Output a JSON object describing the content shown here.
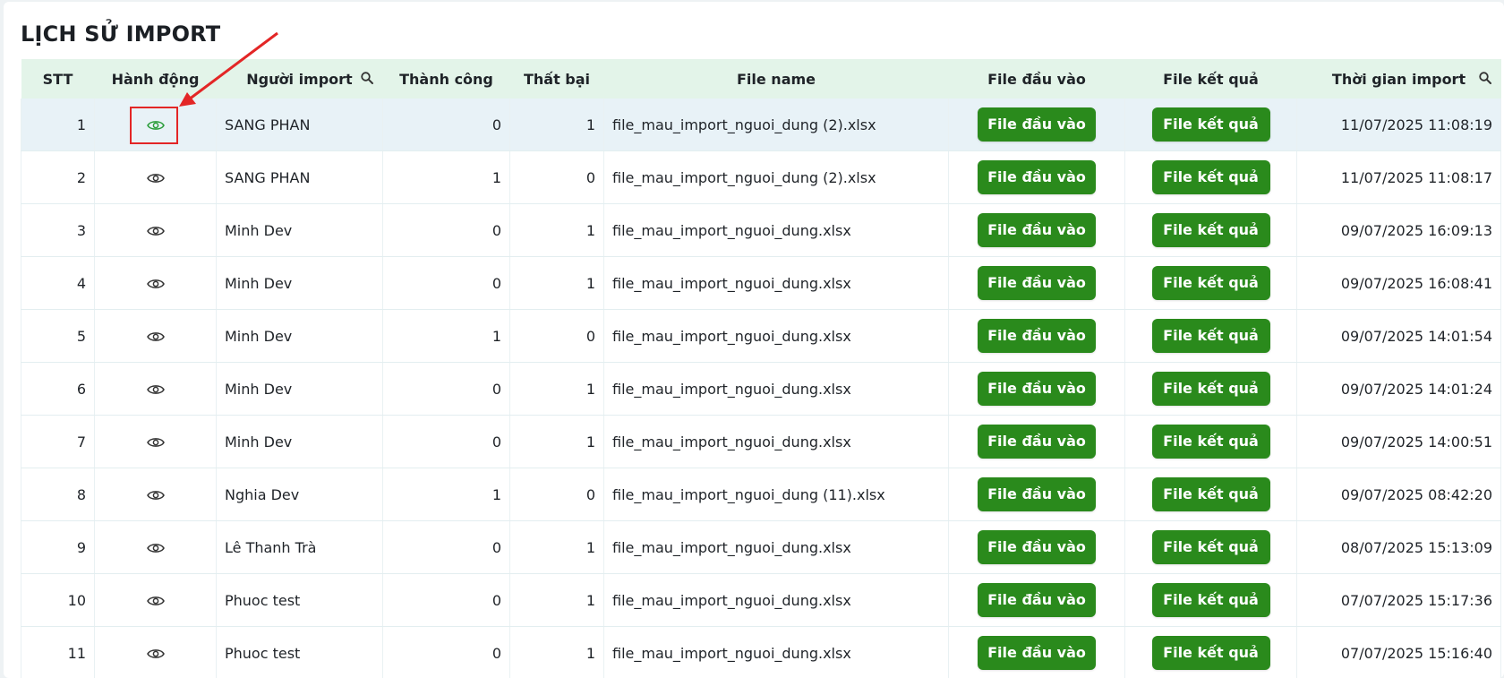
{
  "page": {
    "title": "LỊCH SỬ IMPORT"
  },
  "table": {
    "columns": [
      {
        "label": "STT"
      },
      {
        "label": "Hành động"
      },
      {
        "label": "Người import",
        "icon": "search-icon"
      },
      {
        "label": "Thành công"
      },
      {
        "label": "Thất bại"
      },
      {
        "label": "File name"
      },
      {
        "label": "File đầu vào"
      },
      {
        "label": "File kết quả"
      },
      {
        "label": "Thời gian import",
        "icon": "search-icon"
      }
    ],
    "action_icon": "eye-icon",
    "input_button_label": "File đầu vào",
    "result_button_label": "File kết quả",
    "rows": [
      {
        "stt": "1",
        "user": "SANG PHAN",
        "success": "0",
        "failed": "1",
        "file_name": "file_mau_import_nguoi_dung (2).xlsx",
        "time": "11/07/2025 11:08:19",
        "selected": true
      },
      {
        "stt": "2",
        "user": "SANG PHAN",
        "success": "1",
        "failed": "0",
        "file_name": "file_mau_import_nguoi_dung (2).xlsx",
        "time": "11/07/2025 11:08:17"
      },
      {
        "stt": "3",
        "user": "Minh Dev",
        "success": "0",
        "failed": "1",
        "file_name": "file_mau_import_nguoi_dung.xlsx",
        "time": "09/07/2025 16:09:13"
      },
      {
        "stt": "4",
        "user": "Minh Dev",
        "success": "0",
        "failed": "1",
        "file_name": "file_mau_import_nguoi_dung.xlsx",
        "time": "09/07/2025 16:08:41"
      },
      {
        "stt": "5",
        "user": "Minh Dev",
        "success": "1",
        "failed": "0",
        "file_name": "file_mau_import_nguoi_dung.xlsx",
        "time": "09/07/2025 14:01:54"
      },
      {
        "stt": "6",
        "user": "Minh Dev",
        "success": "0",
        "failed": "1",
        "file_name": "file_mau_import_nguoi_dung.xlsx",
        "time": "09/07/2025 14:01:24"
      },
      {
        "stt": "7",
        "user": "Minh Dev",
        "success": "0",
        "failed": "1",
        "file_name": "file_mau_import_nguoi_dung.xlsx",
        "time": "09/07/2025 14:00:51"
      },
      {
        "stt": "8",
        "user": "Nghia Dev",
        "success": "1",
        "failed": "0",
        "file_name": "file_mau_import_nguoi_dung (11).xlsx",
        "time": "09/07/2025 08:42:20"
      },
      {
        "stt": "9",
        "user": "Lê Thanh Trà",
        "success": "0",
        "failed": "1",
        "file_name": "file_mau_import_nguoi_dung.xlsx",
        "time": "08/07/2025 15:13:09"
      },
      {
        "stt": "10",
        "user": "Phuoc test",
        "success": "0",
        "failed": "1",
        "file_name": "file_mau_import_nguoi_dung.xlsx",
        "time": "07/07/2025 15:17:36"
      },
      {
        "stt": "11",
        "user": "Phuoc test",
        "success": "0",
        "failed": "1",
        "file_name": "file_mau_import_nguoi_dung.xlsx",
        "time": "07/07/2025 15:16:40"
      }
    ]
  },
  "colors": {
    "header_bg": "#e3f4e9",
    "button_bg": "#2a8a1c",
    "selected_row_bg": "#e8f2f7",
    "selected_eye_icon": "#2a9d3a",
    "eye_icon": "#333333",
    "annotation": "#e32626"
  },
  "annotation": {
    "type": "arrow-and-box",
    "target": "row-1-view-icon"
  }
}
